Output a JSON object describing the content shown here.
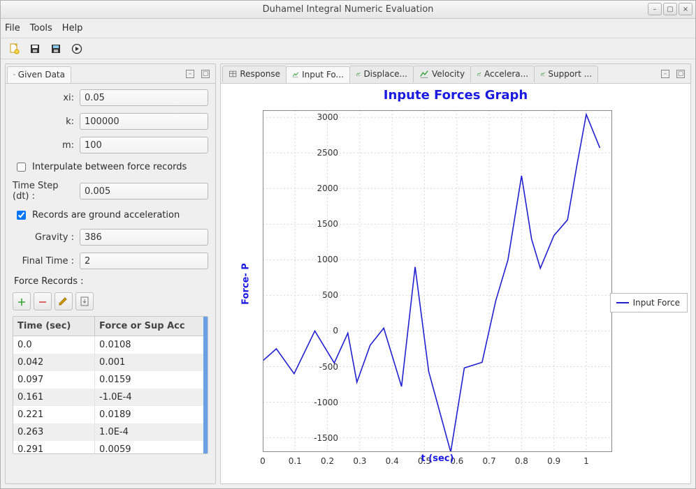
{
  "window": {
    "title": "Duhamel Integral Numeric Evaluation"
  },
  "menu": {
    "file": "File",
    "tools": "Tools",
    "help": "Help"
  },
  "left_panel": {
    "title": "Given Data",
    "labels": {
      "xi": "xi:",
      "k": "k:",
      "m": "m:",
      "interpolate": "Interpulate between force records",
      "dt": "Time Step (dt) :",
      "ground_acc": "Records are ground acceleration",
      "gravity": "Gravity :",
      "final_time": "Final Time :",
      "force_records": "Force Records :"
    },
    "values": {
      "xi": "0.05",
      "k": "100000",
      "m": "100",
      "dt": "0.005",
      "gravity": "386",
      "final_time": "2",
      "interpolate_checked": false,
      "ground_acc_checked": true
    },
    "table": {
      "col_time": "Time (sec)",
      "col_force": "Force or Sup Acc",
      "rows": [
        {
          "t": "0.0",
          "f": "0.0108"
        },
        {
          "t": "0.042",
          "f": "0.001"
        },
        {
          "t": "0.097",
          "f": "0.0159"
        },
        {
          "t": "0.161",
          "f": "-1.0E-4"
        },
        {
          "t": "0.221",
          "f": "0.0189"
        },
        {
          "t": "0.263",
          "f": "1.0E-4"
        },
        {
          "t": "0.291",
          "f": "0.0059"
        }
      ]
    }
  },
  "right_panel": {
    "tabs": [
      "Response",
      "Input Fo...",
      "Displace...",
      "Velocity",
      "Accelera...",
      "Support ..."
    ],
    "active_tab": 1
  },
  "legend": {
    "label": "Input Force"
  },
  "chart_data": {
    "type": "line",
    "title": "Inpute Forces Graph",
    "xlabel": "t (sec)",
    "ylabel": "Force- P",
    "xlim": [
      0,
      1.08
    ],
    "ylim": [
      -1700,
      3100
    ],
    "xticks": [
      0,
      0.1,
      0.2,
      0.3,
      0.4,
      0.5,
      0.6,
      0.7,
      0.8,
      0.9,
      1
    ],
    "yticks": [
      -1500,
      -1000,
      -500,
      0,
      500,
      1000,
      1500,
      2000,
      2500,
      3000
    ],
    "series": [
      {
        "name": "Input Force",
        "x": [
          0,
          0.042,
          0.097,
          0.161,
          0.221,
          0.263,
          0.291,
          0.332,
          0.374,
          0.429,
          0.471,
          0.513,
          0.581,
          0.623,
          0.678,
          0.72,
          0.758,
          0.8,
          0.831,
          0.858,
          0.9,
          0.942,
          0.97,
          1.0,
          1.042
        ],
        "y": [
          -420,
          -250,
          -600,
          0,
          -450,
          -30,
          -720,
          -200,
          40,
          -780,
          900,
          -570,
          -1700,
          -520,
          -440,
          420,
          1000,
          2180,
          1290,
          880,
          1340,
          1560,
          2300,
          3040,
          2570
        ]
      }
    ]
  }
}
